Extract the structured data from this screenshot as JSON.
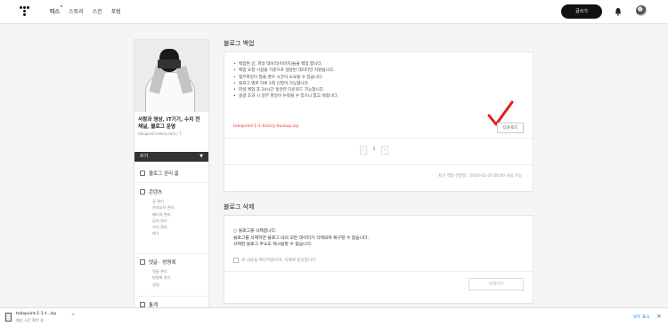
{
  "topbar": {
    "nav": [
      "티스",
      "스토리",
      "스킨",
      "포럼"
    ],
    "write_button": "글쓰기"
  },
  "sidebar": {
    "blog_title": "사람과 영상, IT기기, 수치 전 채널, 블로그 운영",
    "blog_url": "tokopoint.tistory.com / 7",
    "write_label": "쓰기",
    "manage_label": "블로그 관리 홈",
    "content_header": "콘텐츠",
    "content_items": [
      "글 관리",
      "카테고리 관리",
      "페이지 관리",
      "공지 관리",
      "서식 관리",
      "태그"
    ],
    "comment_header": "댓글 · 방명록",
    "comment_items": [
      "댓글 관리",
      "방명록 관리",
      "설정"
    ],
    "stats_header": "통계"
  },
  "backup": {
    "title": "블로그 백업",
    "bullets": [
      "백업된 글, 파일 데이터(이미지)들을 백업 합니다.",
      "백업 요청 시점을 기준으로 생성된 데이터만 지원됩니다.",
      "첨부파일이 많을 경우 시간이 소요될 수 있습니다.",
      "블로그 별로 하루 1회 신청이 가능합니다.",
      "파일 백업 후 24시간 동안만 다운로드 가능합니다.",
      "용량 초과 시 일부 파일이 누락될 수 있으니 참고 바랍니다."
    ],
    "file_link": "tokopoint-1-1-tistory-backup.zip",
    "download_button": "다운로드",
    "page_current": "1",
    "footnote": "최근 백업 신청일 : 2020-03-24 00:00 사용 가능"
  },
  "delete": {
    "title": "블로그 삭제",
    "lines": [
      "○ 블로그를 삭제합니다.",
      "블로그를 삭제하면 블로그 내의 모든 데이터가 삭제되며 복구할 수 없습니다.",
      "삭제된 블로그 주소도 재사용할 수 없습니다."
    ],
    "agree_text": "위 내용을 확인하였으며, 삭제에 동의합니다.",
    "delete_button": "삭제하기"
  },
  "download_bar": {
    "file_name": "tokopoint-1-1-t...zip",
    "file_sub": "예상 시간 확인 중",
    "show_all": "모두 표시"
  }
}
